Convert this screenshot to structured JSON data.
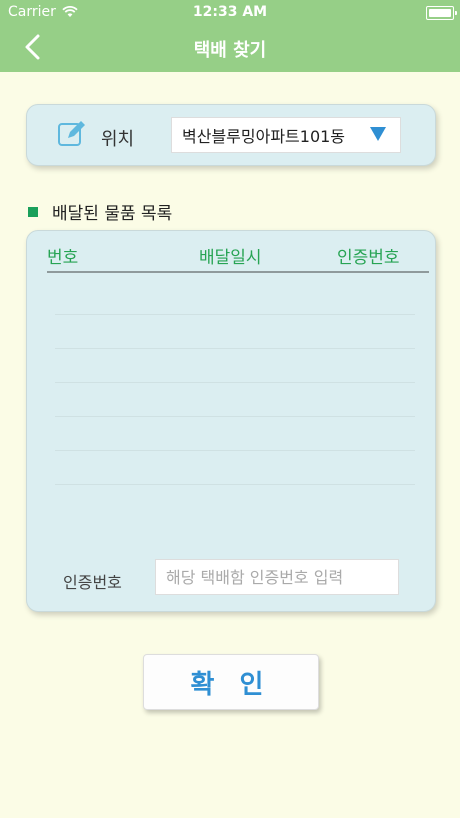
{
  "status_bar": {
    "carrier": "Carrier",
    "time": "12:33 AM"
  },
  "nav": {
    "title": "택배 찾기",
    "back_icon": "chevron-left-icon"
  },
  "location": {
    "label": "위치",
    "selected": "벽산블루밍아파트101동",
    "icon": "edit-icon"
  },
  "list": {
    "section_title": "배달된 물품 목록",
    "headers": [
      "번호",
      "배달일시",
      "인증번호"
    ],
    "rows": []
  },
  "auth": {
    "label": "인증번호",
    "placeholder": "해당 택배함 인증번호 입력",
    "value": ""
  },
  "confirm_label": "확 인",
  "colors": {
    "header_bg": "#96cf87",
    "background": "#fbfce6",
    "panel_bg": "#dbeef1",
    "accent_green": "#27a454",
    "accent_blue": "#2f8fd3"
  }
}
